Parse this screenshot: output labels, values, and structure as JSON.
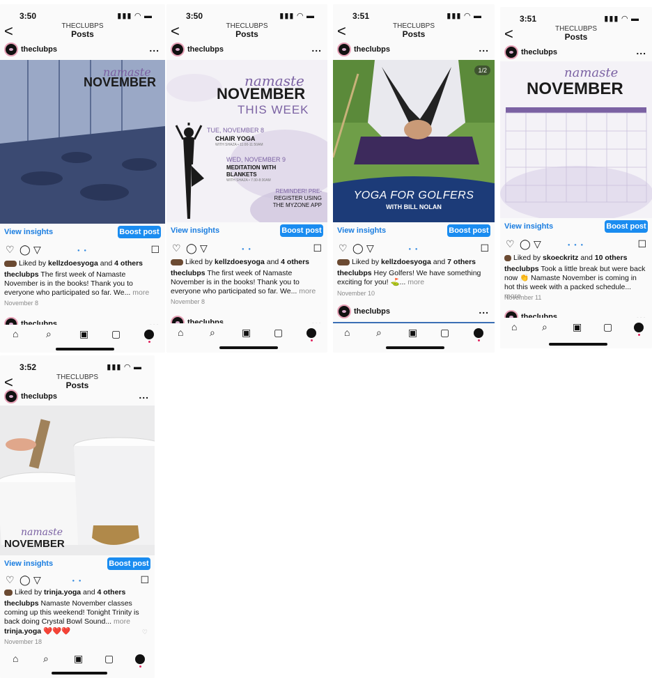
{
  "screens": [
    {
      "status": {
        "time": "3:50",
        "icons": "▮▮▮ ◠ ▬"
      },
      "header": {
        "account": "THECLUBPS",
        "title": "Posts",
        "back": "<"
      },
      "post": {
        "username": "theclubps",
        "more": "...",
        "image_text": {
          "script": "namaste",
          "big": "NOVEMBER"
        },
        "view_insights": "View insights",
        "boost": "Boost post",
        "likes_prefix": "Liked by ",
        "likes_user": "kellzdoesyoga",
        "likes_suffix": " and ",
        "likes_others": "4 others",
        "caption_user": "theclubps",
        "caption": " The first week of Namaste November is in the books! Thank you to everyone who participated so far. We...",
        "more_label": " more",
        "date": "November 8"
      },
      "next_username": "theclubps"
    },
    {
      "status": {
        "time": "3:50",
        "icons": "▮▮▮ ◠ ▬"
      },
      "header": {
        "account": "THECLUBPS",
        "title": "Posts",
        "back": "<"
      },
      "post": {
        "username": "theclubps",
        "more": "...",
        "image_text": {
          "script": "namaste",
          "big": "NOVEMBER",
          "sub": "THIS WEEK",
          "ev1_date": "TUE, NOVEMBER 8",
          "ev1_name": "CHAIR YOGA",
          "ev1_with": "WITH SHAZA • 11:00-11:50AM",
          "ev2_date": "WED, NOVEMBER 9",
          "ev2_name1": "MEDITATION WITH",
          "ev2_name2": "BLANKETS",
          "ev2_with": "WITH SHAZA • 7:30-8:30AM",
          "rem1": "REMINDER! PRE-",
          "rem2": "REGISTER USING",
          "rem3": "THE MYZONE APP"
        },
        "view_insights": "View insights",
        "boost": "Boost post",
        "likes_prefix": "Liked by ",
        "likes_user": "kellzdoesyoga",
        "likes_suffix": " and ",
        "likes_others": "4 others",
        "caption_user": "theclubps",
        "caption": " The first week of Namaste November is in the books! Thank you to everyone who participated so far. We...",
        "more_label": " more",
        "date": "November 8"
      },
      "next_username": "theclubps"
    },
    {
      "status": {
        "time": "3:51",
        "icons": "▮▮▮ ◠ ▬"
      },
      "header": {
        "account": "THECLUBPS",
        "title": "Posts",
        "back": "<"
      },
      "post": {
        "username": "theclubps",
        "more": "...",
        "image_text": {
          "counter": "1/2",
          "banner1": "YOGA FOR GOLFERS",
          "banner2": "WITH BILL NOLAN"
        },
        "view_insights": "View insights",
        "boost": "Boost post",
        "likes_prefix": "Liked by ",
        "likes_user": "kellzdoesyoga",
        "likes_suffix": " and ",
        "likes_others": "7 others",
        "caption_user": "theclubps",
        "caption": " Hey Golfers! We have something exciting for you! ⛳...",
        "more_label": " more",
        "date": "November 10"
      },
      "next_username": "theclubps"
    },
    {
      "status": {
        "time": "3:51",
        "icons": "▮▮▮ ◠ ▬"
      },
      "header": {
        "account": "THECLUBPS",
        "title": "Posts",
        "back": "<"
      },
      "post": {
        "username": "theclubps",
        "more": "...",
        "image_text": {
          "script": "namaste",
          "big": "NOVEMBER"
        },
        "view_insights": "View insights",
        "boost": "Boost post",
        "likes_prefix": "Liked by ",
        "likes_user": "skoeckritz",
        "likes_suffix": " and ",
        "likes_others": "10 others",
        "caption_user": "theclubps",
        "caption": " Took a little break but were back now 👏 Namaste November is coming in hot this week with a packed schedule...",
        "more_label": " more",
        "date": "November 11"
      },
      "next_username": "theclubps"
    },
    {
      "status": {
        "time": "3:52",
        "icons": "▮▮▮ ◠ ▬"
      },
      "header": {
        "account": "THECLUBPS",
        "title": "Posts",
        "back": "<"
      },
      "post": {
        "username": "theclubps",
        "more": "...",
        "image_text": {
          "script": "namaste",
          "big": "NOVEMBER"
        },
        "view_insights": "View insights",
        "boost": "Boost post",
        "likes_prefix": "Liked by ",
        "likes_user": "trinja.yoga",
        "likes_suffix": " and ",
        "likes_others": "4 others",
        "caption_user": "theclubps",
        "caption": " Namaste November classes coming up this weekend! Tonight Trinity is back doing Crystal Bowl Sound...",
        "more_label": " more",
        "comment_user": "trinja.yoga",
        "comment_text": " ❤️❤️❤️",
        "date": "November 18"
      }
    }
  ],
  "icons": {
    "heart": "♡",
    "comment": "◯",
    "share": "▽",
    "save": "☐",
    "home": "⌂",
    "search": "⌕",
    "reels": "▣",
    "shop": "▢"
  },
  "colors": {
    "accent": "#1a8cf0",
    "purple": "#7b62a3",
    "banner": "#1c3b78"
  }
}
